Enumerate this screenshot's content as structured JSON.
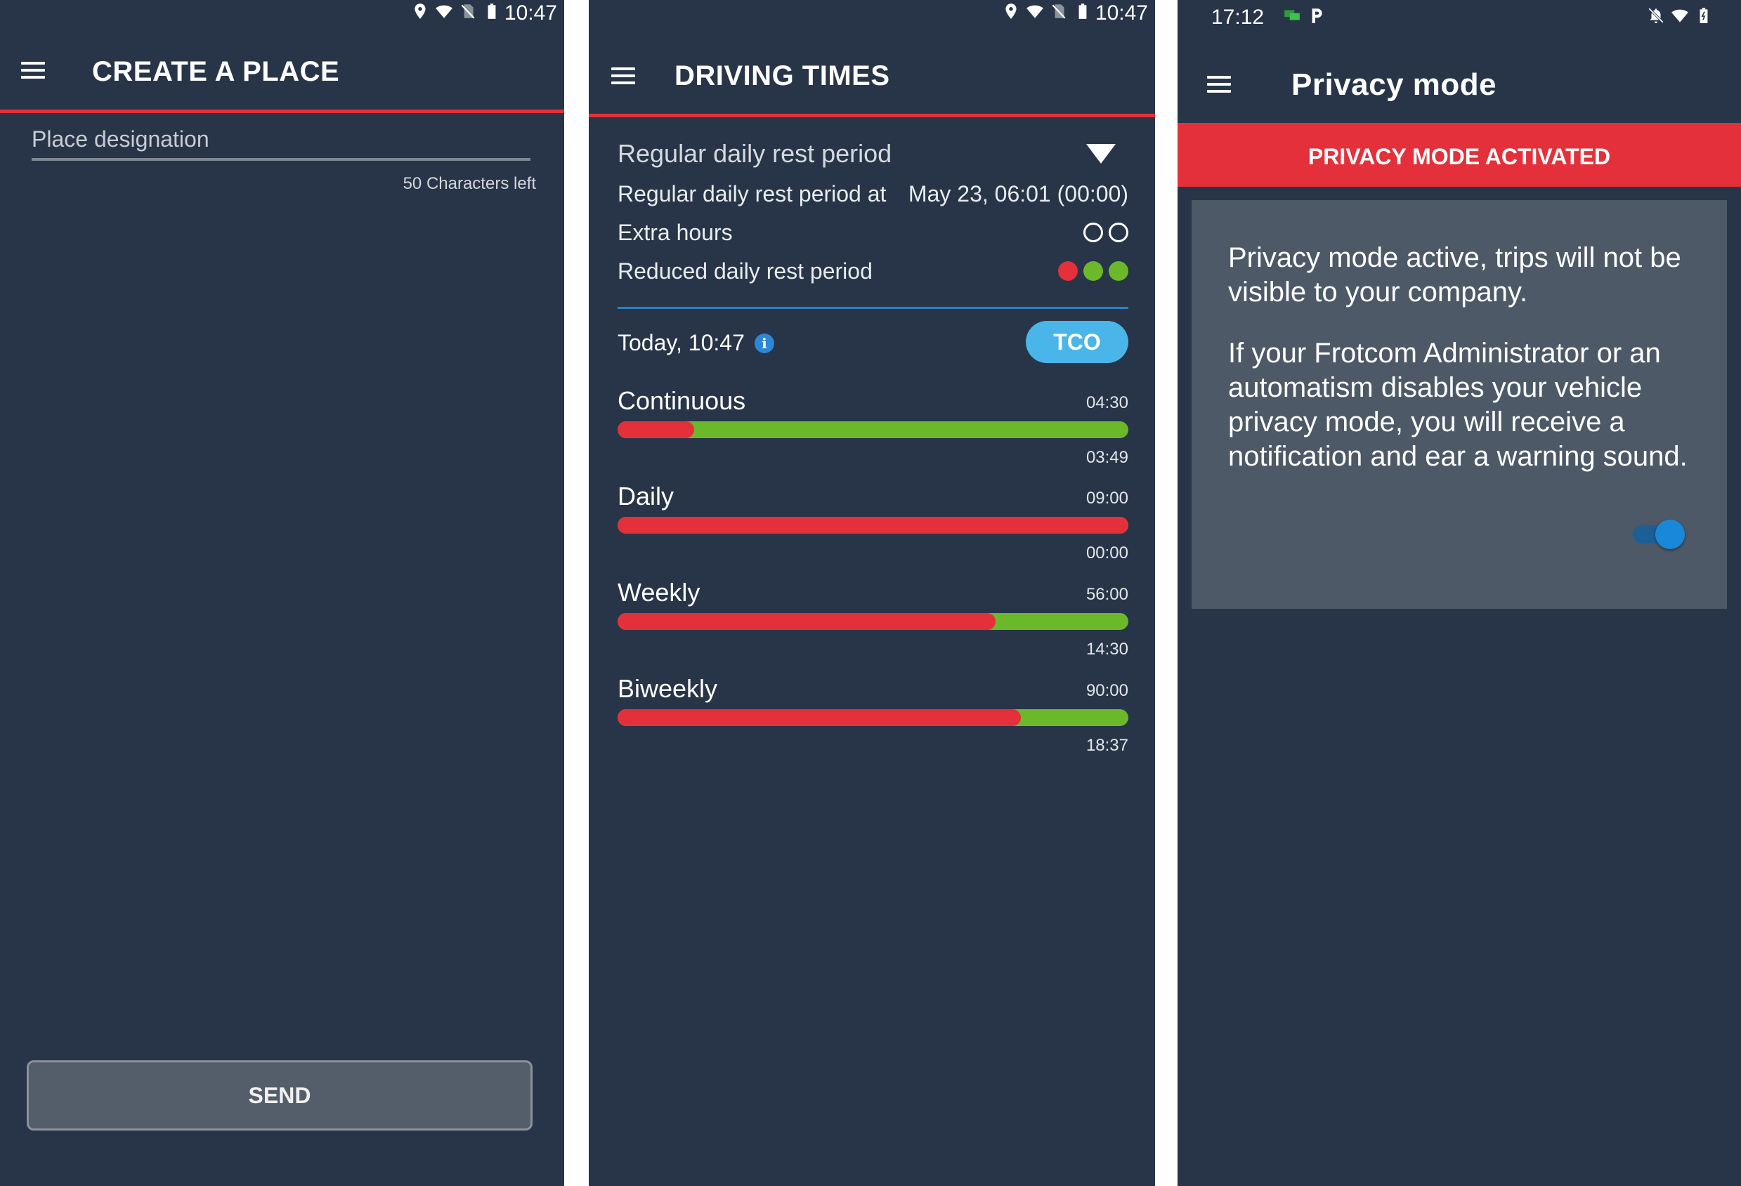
{
  "colors": {
    "bg": "#283548",
    "accent_red": "#e4303a",
    "green": "#6cb82b",
    "blue": "#4ab5e8"
  },
  "panel1": {
    "status": {
      "time": "10:47",
      "icons": [
        "location-icon",
        "wifi-icon",
        "no-sim-icon",
        "battery-icon"
      ]
    },
    "title": "CREATE A PLACE",
    "field_placeholder": "Place designation",
    "counter": "50 Characters left",
    "send_label": "SEND"
  },
  "panel2": {
    "status": {
      "time": "10:47",
      "icons": [
        "location-icon",
        "wifi-icon",
        "no-sim-icon",
        "battery-icon"
      ]
    },
    "title": "DRIVING TIMES",
    "rest_header": "Regular daily rest period",
    "rows": [
      {
        "label": "Regular daily rest period at",
        "value": "May 23, 06:01 (00:00)"
      },
      {
        "label": "Extra hours"
      },
      {
        "label": "Reduced daily rest period"
      }
    ],
    "extra_hours_used": 0,
    "extra_hours_total": 2,
    "reduced_dots": [
      "#e4303a",
      "#6cb82b",
      "#6cb82b"
    ],
    "today": "Today, 10:47",
    "info_glyph": "i",
    "tco_label": "TCO",
    "bars": [
      {
        "name": "Continuous",
        "max": "04:30",
        "remaining": "03:49",
        "used_fraction": 0.15
      },
      {
        "name": "Daily",
        "max": "09:00",
        "remaining": "00:00",
        "used_fraction": 1.0
      },
      {
        "name": "Weekly",
        "max": "56:00",
        "remaining": "14:30",
        "used_fraction": 0.74
      },
      {
        "name": "Biweekly",
        "max": "90:00",
        "remaining": "18:37",
        "used_fraction": 0.79
      }
    ]
  },
  "panel3": {
    "status": {
      "time": "17:12",
      "left_icons": [
        "chat-icon",
        "parking-icon"
      ],
      "right_icons": [
        "notifications-off-icon",
        "wifi-icon",
        "battery-icon"
      ]
    },
    "title": "Privacy mode",
    "banner": "PRIVACY MODE ACTIVATED",
    "paragraph1": "Privacy mode active, trips will not be visible to your company.",
    "paragraph2": "If your Frotcom Administrator or an automatism disables your vehicle privacy mode, you will receive a notification and ear a warning sound.",
    "toggle_on": true
  }
}
